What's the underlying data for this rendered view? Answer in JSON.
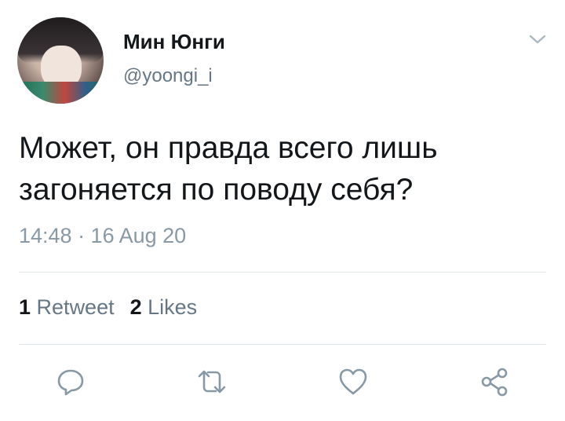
{
  "author": {
    "display_name": "Мин Юнги",
    "handle": "@yoongi_i"
  },
  "tweet": {
    "text_line1": "Может, он правда всего лишь",
    "text_line2": "загоняется по поводу себя?",
    "timestamp": "14:48 · 16 Aug 20"
  },
  "stats": {
    "retweets_count": "1",
    "retweets_label": "Retweet",
    "likes_count": "2",
    "likes_label": "Likes"
  },
  "actions": [
    {
      "icon": "reply-icon"
    },
    {
      "icon": "retweet-icon"
    },
    {
      "icon": "like-icon"
    },
    {
      "icon": "share-icon"
    }
  ],
  "colors": {
    "text": "#14171a",
    "secondary": "#657786",
    "icon": "#8899a6",
    "divider": "#e1e8ed"
  }
}
